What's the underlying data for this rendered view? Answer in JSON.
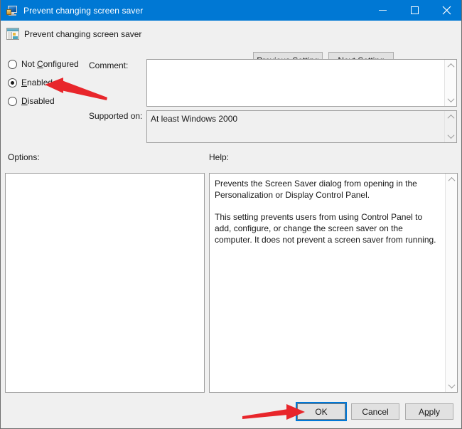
{
  "window": {
    "title": "Prevent changing screen saver",
    "icon": "monitor-icon",
    "controls": {
      "minimize": "minimize-icon",
      "maximize": "maximize-icon",
      "close": "close-icon"
    }
  },
  "header": {
    "icon": "policy-setting-icon",
    "title": "Prevent changing screen saver",
    "previous_setting": "Previous Setting",
    "previous_setting_pre": "P",
    "previous_setting_post": "revious Setting",
    "next_setting": "Next Setting",
    "next_setting_pre": "N",
    "next_setting_post": "ext Setting"
  },
  "state_options": {
    "selected": "Enabled",
    "items": [
      {
        "label": "Not Configured",
        "pre": "Not ",
        "accel": "C",
        "post": "onfigured",
        "checked": false
      },
      {
        "label": "Enabled",
        "pre": "",
        "accel": "E",
        "post": "nabled",
        "checked": true
      },
      {
        "label": "Disabled",
        "pre": "",
        "accel": "D",
        "post": "isabled",
        "checked": false
      }
    ]
  },
  "fields": {
    "comment_label": "Comment:",
    "comment_value": "",
    "supported_label": "Supported on:",
    "supported_value": "At least Windows 2000"
  },
  "panes": {
    "options_label": "Options:",
    "options_content": "",
    "help_label": "Help:",
    "help_paragraphs": [
      "Prevents the Screen Saver dialog from opening in the Personalization or Display Control Panel.",
      "This setting prevents users from using Control Panel to add, configure, or change the screen saver on the computer. It does not prevent a screen saver from running."
    ]
  },
  "footer": {
    "ok": "OK",
    "cancel": "Cancel",
    "apply": "Apply",
    "apply_pre": "A",
    "apply_accel": "p",
    "apply_post": "ply",
    "focused_button": "OK"
  },
  "annotations": {
    "arrow_color": "#e8262b",
    "arrows": [
      {
        "name": "arrow-pointing-to-enabled",
        "target": "Enabled"
      },
      {
        "name": "arrow-pointing-to-ok",
        "target": "OK"
      }
    ]
  },
  "colors": {
    "titlebar": "#0078d4",
    "dialog_background": "#f0f0f0",
    "focus_outline": "#0078d7",
    "arrow_red": "#e8262b"
  }
}
